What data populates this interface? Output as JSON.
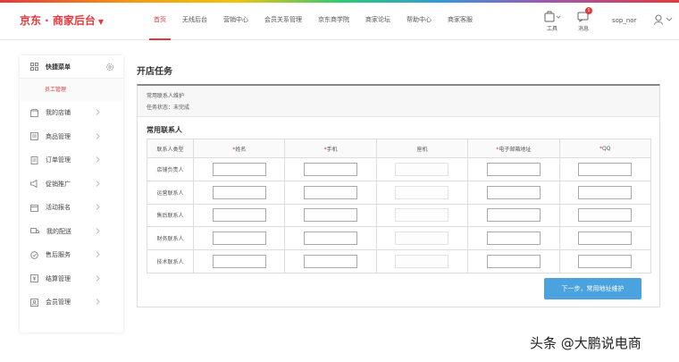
{
  "brand": {
    "logo_text": "京东 · 商家后台",
    "accent": "#e4393c"
  },
  "nav": {
    "items": [
      "首页",
      "无线后台",
      "营销中心",
      "会员关系管理",
      "京东商学院",
      "商家论坛",
      "帮助中心",
      "商家客服"
    ]
  },
  "header_tools": {
    "tools_label": "工具",
    "messages_label": "消息",
    "messages_count": "1",
    "username": "sop_nor"
  },
  "sidebar": {
    "title": "快捷菜单",
    "sub_item": "员工管理",
    "items": [
      "我的店铺",
      "商品管理",
      "订单管理",
      "促销推广",
      "活动报名",
      "我的配送",
      "售后服务",
      "结算管理",
      "会员管理"
    ]
  },
  "page": {
    "title": "开店任务",
    "info_line1": "常用联系人维护",
    "info_line2": "任务状态：未完成",
    "section_title": "常用联系人",
    "columns": [
      "联系人类型",
      "姓名",
      "手机",
      "座机",
      "电子邮箱地址",
      "QQ"
    ],
    "rows": [
      "店铺负责人",
      "运营联系人",
      "售后联系人",
      "财务联系人",
      "技术联系人"
    ],
    "next_button": "下一步，常用地址维护",
    "button_color": "#4aa3df"
  },
  "watermark": "头条 @大鹏说电商"
}
